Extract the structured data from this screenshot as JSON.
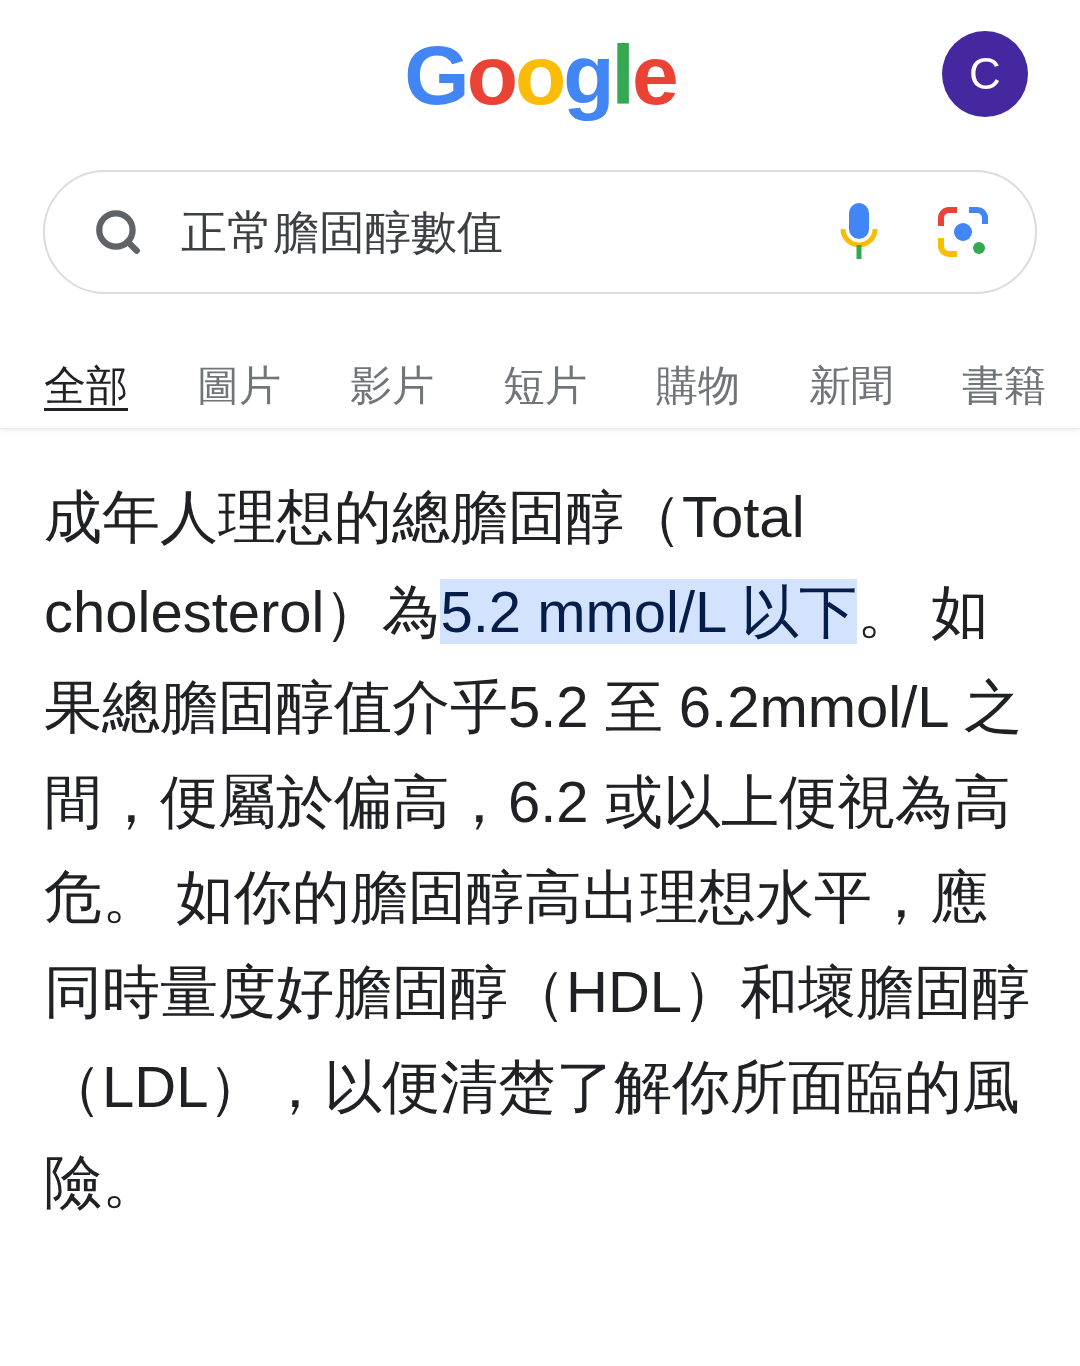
{
  "logo": "Google",
  "avatar": {
    "initial": "C"
  },
  "search": {
    "value": "正常膽固醇數值"
  },
  "tabs": [
    {
      "label": "全部",
      "selected": true
    },
    {
      "label": "圖片",
      "selected": false
    },
    {
      "label": "影片",
      "selected": false
    },
    {
      "label": "短片",
      "selected": false
    },
    {
      "label": "購物",
      "selected": false
    },
    {
      "label": "新聞",
      "selected": false
    },
    {
      "label": "書籍",
      "selected": false
    }
  ],
  "answer": {
    "segments": [
      {
        "text": "成年人理想的總膽固醇（Total cholesterol）為",
        "highlighted": false
      },
      {
        "text": "5.2 mmol/L 以下",
        "highlighted": true
      },
      {
        "text": "。 如果總膽固醇值介乎5.2 至 6.2mmol/L 之間，便屬於偏高，6.2 或以上便視為高危。 如你的膽固醇高出理想水平，應同時量度好膽固醇（HDL）和壞膽固醇（LDL），以便清楚了解你所面臨的風險。",
        "highlighted": false
      }
    ]
  }
}
